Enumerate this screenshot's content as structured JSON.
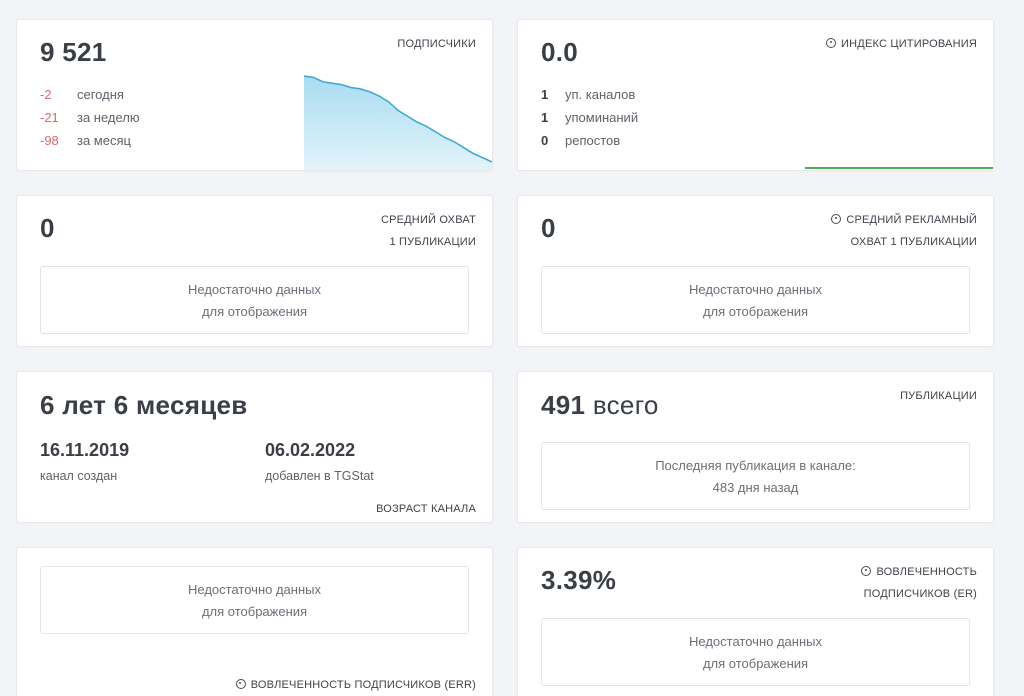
{
  "subscribers": {
    "count": "9 521",
    "label": "подписчики",
    "stats": [
      {
        "value": "-2",
        "text": "сегодня"
      },
      {
        "value": "-21",
        "text": "за неделю"
      },
      {
        "value": "-98",
        "text": "за месяц"
      }
    ],
    "sparkline": [
      100,
      99,
      96,
      95,
      94,
      92,
      91,
      89,
      86,
      82,
      76,
      72,
      68,
      65,
      61,
      57,
      54,
      50,
      46,
      43,
      40
    ]
  },
  "citation": {
    "value": "0.0",
    "label": "индекс цитирования",
    "stats": [
      {
        "value": "1",
        "text": "уп. каналов"
      },
      {
        "value": "1",
        "text": "упоминаний"
      },
      {
        "value": "0",
        "text": "репостов"
      }
    ]
  },
  "avg_reach": {
    "value": "0",
    "label_line1": "средний охват",
    "label_line2": "1 публикации",
    "empty_line1": "Недостаточно данных",
    "empty_line2": "для отображения"
  },
  "avg_ad_reach": {
    "value": "0",
    "label_line1": "средний рекламный",
    "label_line2": "охват 1 публикации",
    "empty_line1": "Недостаточно данных",
    "empty_line2": "для отображения"
  },
  "age": {
    "value": "6 лет 6 месяцев",
    "created_date": "16.11.2019",
    "created_label": "канал создан",
    "added_date": "06.02.2022",
    "added_label": "добавлен в TGStat",
    "label": "возраст канала"
  },
  "publications": {
    "count": "491",
    "suffix": "всего",
    "label": "публикации",
    "last_line1": "Последняя публикация в канале:",
    "last_line2": "483 дня назад"
  },
  "err": {
    "empty_line1": "Недостаточно данных",
    "empty_line2": "для отображения",
    "label": "вовлеченность подписчиков (ERR)"
  },
  "er": {
    "value": "3.39%",
    "label_line1": "вовлеченность",
    "label_line2": "подписчиков (ER)",
    "empty_line1": "Недостаточно данных",
    "empty_line2": "для отображения"
  },
  "colors": {
    "negative": "#e1656c",
    "sparkline_stroke": "#3aa7d6",
    "sparkline_fill_top": "#b7e1f3",
    "citation_line": "#4caf50"
  }
}
